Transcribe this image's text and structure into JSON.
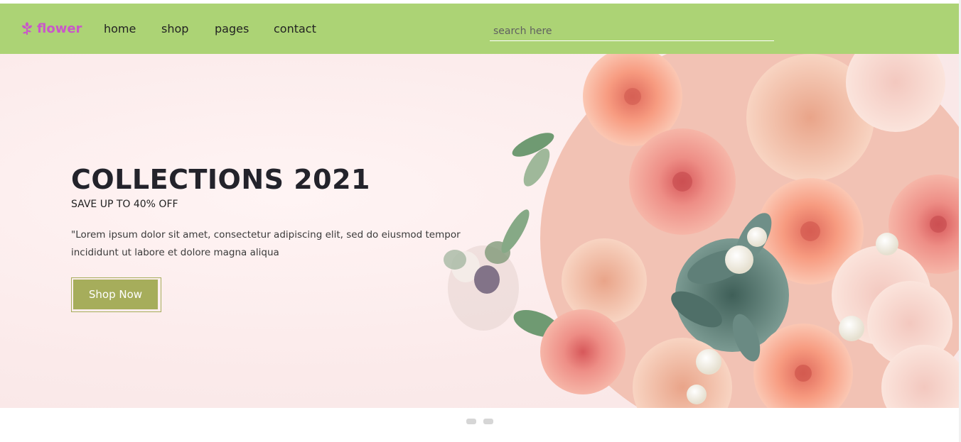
{
  "brand": {
    "name": "flower",
    "icon": "flower-icon",
    "color": "#c957c9"
  },
  "nav": {
    "items": [
      {
        "label": "home"
      },
      {
        "label": "shop"
      },
      {
        "label": "pages"
      },
      {
        "label": "contact"
      }
    ]
  },
  "search": {
    "placeholder": "search here",
    "value": ""
  },
  "hero": {
    "title": "COLLECTIONS 2021",
    "subtitle": "SAVE UP TO 40% OFF",
    "description": "\"Lorem ipsum dolor sit amet, consectetur adipiscing elit, sed do eiusmod tempor incididunt ut labore et dolore magna aliqua",
    "button_label": "Shop Now",
    "image": "flower-bouquet-image"
  },
  "carousel": {
    "dots": 2
  },
  "colors": {
    "navbar": "#acd375",
    "accent": "#a6ad5b",
    "hero_bg": "#fceeee",
    "title": "#23232b"
  }
}
